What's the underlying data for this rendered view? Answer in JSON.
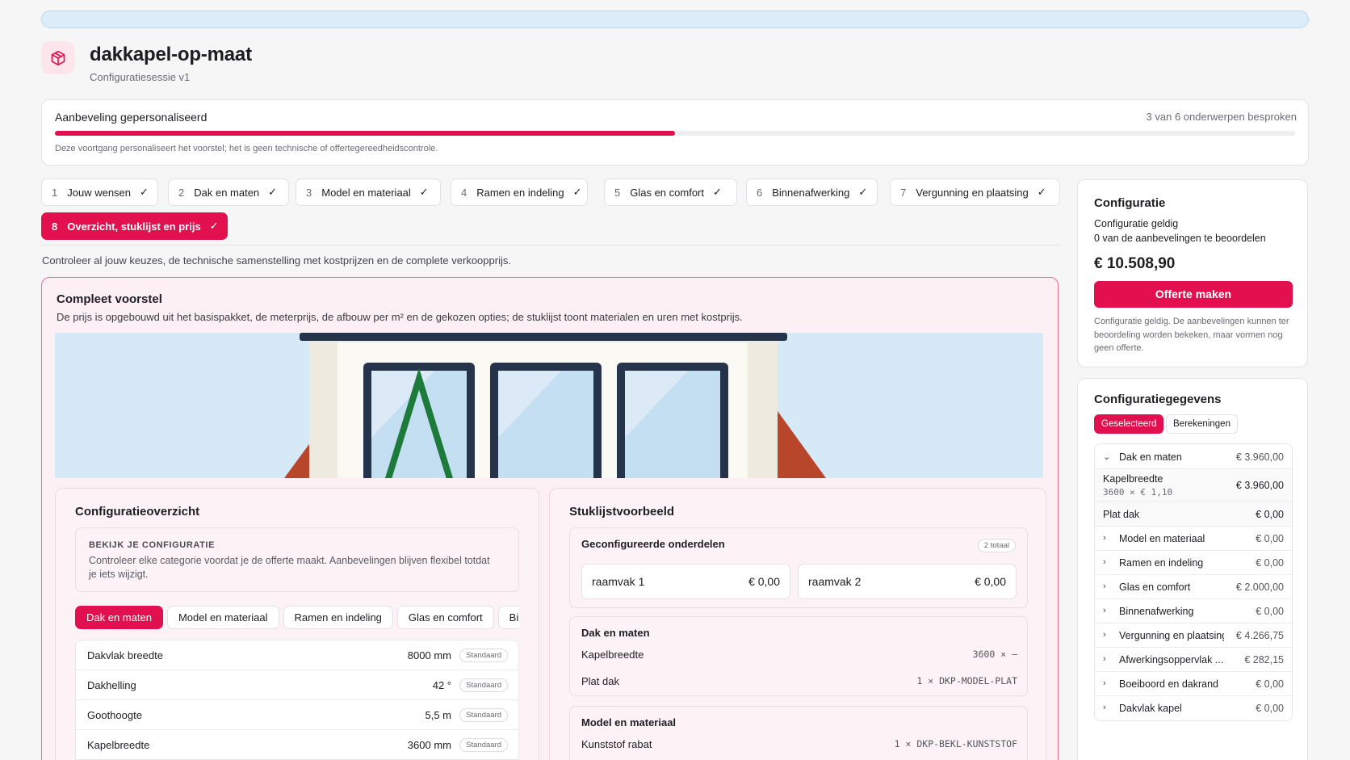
{
  "app": {
    "title": "dakkapel-op-maat",
    "subtitle": "Configuratiesessie v1"
  },
  "progress": {
    "title": "Aanbeveling gepersonaliseerd",
    "count": "3 van 6 onderwerpen besproken",
    "fraction": 0.5,
    "note": "Deze voortgang personaliseert het voorstel; het is geen technische of offertegereedheidscontrole."
  },
  "steps": [
    {
      "num": "1",
      "label": "Jouw wensen",
      "check": "✓"
    },
    {
      "num": "2",
      "label": "Dak en maten",
      "check": "✓"
    },
    {
      "num": "3",
      "label": "Model en materiaal",
      "check": "✓"
    },
    {
      "num": "4",
      "label": "Ramen en indeling",
      "check": "✓"
    },
    {
      "num": "5",
      "label": "Glas en comfort",
      "check": "✓"
    },
    {
      "num": "6",
      "label": "Binnenafwerking",
      "check": "✓"
    },
    {
      "num": "7",
      "label": "Vergunning en plaatsing",
      "check": "✓"
    },
    {
      "num": "8",
      "label": "Overzicht, stuklijst en prijs",
      "check": "✓"
    }
  ],
  "step_description": "Controleer al jouw keuzes, de technische samenstelling met kostprijzen en de complete verkoopprijs.",
  "proposal": {
    "title": "Compleet voorstel",
    "description": "De prijs is opgebouwd uit het basispakket, de meterprijs, de afbouw per m² en de gekozen opties; de stuklijst toont materialen en uren met kostprijs."
  },
  "overview": {
    "title": "Configuratieoverzicht",
    "review_heading": "BEKIJK JE CONFIGURATIE",
    "review_text": "Controleer elke categorie voordat je de offerte maakt. Aanbevelingen blijven flexibel totdat je iets wijzigt.",
    "tabs": [
      "Dak en maten",
      "Model en materiaal",
      "Ramen en indeling",
      "Glas en comfort",
      "Binnenafwerking"
    ],
    "rows": [
      {
        "label": "Dakvlak breedte",
        "value": "8000 mm",
        "badge": "Standaard"
      },
      {
        "label": "Dakhelling",
        "value": "42 °",
        "badge": "Standaard"
      },
      {
        "label": "Goothoogte",
        "value": "5,5 m",
        "badge": "Standaard"
      },
      {
        "label": "Kapelbreedte",
        "value": "3600 mm",
        "badge": "Standaard"
      }
    ]
  },
  "bom": {
    "title": "Stuklijstvoorbeeld",
    "configured": {
      "title": "Geconfigureerde onderdelen",
      "badge": "2 totaal",
      "parts": [
        {
          "label": "raamvak 1",
          "value": "€ 0,00"
        },
        {
          "label": "raamvak 2",
          "value": "€ 0,00"
        }
      ]
    },
    "groups": [
      {
        "title": "Dak en maten",
        "rows": [
          {
            "label": "Kapelbreedte",
            "value": "3600 × —"
          },
          {
            "label": "Plat dak",
            "value": "1 × DKP-MODEL-PLAT"
          }
        ]
      },
      {
        "title": "Model en materiaal",
        "rows": [
          {
            "label": "Kunststof rabat",
            "value": "1 × DKP-BEKL-KUNSTSTOF"
          }
        ]
      }
    ]
  },
  "summary": {
    "title": "Configuratie",
    "status": "Configuratie geldig",
    "recommendations": "0 van de aanbevelingen te beoordelen",
    "price": "€ 10.508,90",
    "button": "Offerte maken",
    "note": "Configuratie geldig. De aanbevelingen kunnen ter beoordeling worden bekeken, maar vormen nog geen offerte."
  },
  "details": {
    "title": "Configuratiegegevens",
    "tabs": [
      "Geselecteerd",
      "Berekeningen"
    ],
    "expanded": {
      "label": "Dak en maten",
      "value": "€ 3.960,00",
      "children": [
        {
          "label": "Kapelbreedte",
          "sub": "3600 × € 1,10",
          "value": "€ 3.960,00"
        },
        {
          "label": "Plat dak",
          "value": "€ 0,00"
        }
      ]
    },
    "rows": [
      {
        "label": "Model en materiaal",
        "value": "€ 0,00"
      },
      {
        "label": "Ramen en indeling",
        "value": "€ 0,00"
      },
      {
        "label": "Glas en comfort",
        "value": "€ 2.000,00"
      },
      {
        "label": "Binnenafwerking",
        "value": "€ 0,00"
      },
      {
        "label": "Vergunning en plaatsing",
        "value": "€ 4.266,75"
      },
      {
        "label": "Afwerkingsoppervlak ...",
        "value": "€ 282,15"
      },
      {
        "label": "Boeiboord en dakrand",
        "value": "€ 0,00"
      },
      {
        "label": "Dakvlak kapel",
        "value": "€ 0,00"
      }
    ]
  },
  "colors": {
    "accent": "#e2104f",
    "window_frame": "#25344a",
    "roof_tile": "#b8462a",
    "glass": "#c4def2"
  }
}
